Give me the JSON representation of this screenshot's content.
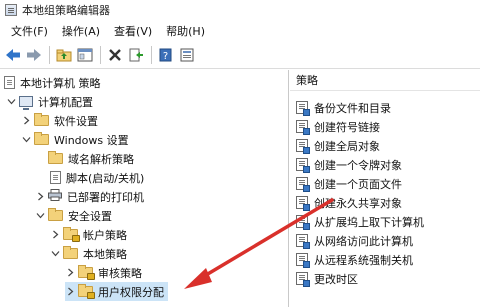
{
  "window": {
    "title": "本地组策略编辑器",
    "icon": "policy-editor-icon"
  },
  "menubar": [
    {
      "label": "文件(F)"
    },
    {
      "label": "操作(A)"
    },
    {
      "label": "查看(V)"
    },
    {
      "label": "帮助(H)"
    }
  ],
  "toolbar": [
    "back-arrow-icon",
    "forward-arrow-icon",
    "up-folder-icon",
    "show-hide-tree-icon",
    "delete-icon",
    "export-list-icon",
    "help-icon",
    "properties-icon"
  ],
  "tree": [
    {
      "label": "本地计算机 策略",
      "icon": "computer-policy-icon",
      "level": 0,
      "expander": ""
    },
    {
      "label": "计算机配置",
      "icon": "computer-icon",
      "level": 1,
      "expander": "down"
    },
    {
      "label": "软件设置",
      "icon": "folder-icon",
      "level": 2,
      "expander": "right"
    },
    {
      "label": "Windows 设置",
      "icon": "folder-icon",
      "level": 2,
      "expander": "down"
    },
    {
      "label": "域名解析策略",
      "icon": "folder-icon",
      "level": 3,
      "expander": ""
    },
    {
      "label": "脚本(启动/关机)",
      "icon": "document-icon",
      "level": 3,
      "expander": ""
    },
    {
      "label": "已部署的打印机",
      "icon": "printer-icon",
      "level": 3,
      "expander": "right"
    },
    {
      "label": "安全设置",
      "icon": "folder-icon",
      "level": 3,
      "expander": "down"
    },
    {
      "label": "帐户策略",
      "icon": "folder-lock-icon",
      "level": 4,
      "expander": "right"
    },
    {
      "label": "本地策略",
      "icon": "folder-icon",
      "level": 4,
      "expander": "down"
    },
    {
      "label": "审核策略",
      "icon": "folder-lock-icon",
      "level": 5,
      "expander": "right"
    },
    {
      "label": "用户权限分配",
      "icon": "folder-lock-icon",
      "level": 5,
      "expander": "right",
      "selected": true
    }
  ],
  "list": {
    "header": "策略",
    "items": [
      {
        "label": "备份文件和目录"
      },
      {
        "label": "创建符号链接"
      },
      {
        "label": "创建全局对象"
      },
      {
        "label": "创建一个令牌对象"
      },
      {
        "label": "创建一个页面文件"
      },
      {
        "label": "创建永久共享对象"
      },
      {
        "label": "从扩展坞上取下计算机"
      },
      {
        "label": "从网络访问此计算机"
      },
      {
        "label": "从远程系统强制关机"
      },
      {
        "label": "更改时区"
      }
    ]
  },
  "annotation": {
    "arrow_color": "#d9302b"
  },
  "colors": {
    "selection": "#cce4f7",
    "folder": "#f3d27a"
  }
}
